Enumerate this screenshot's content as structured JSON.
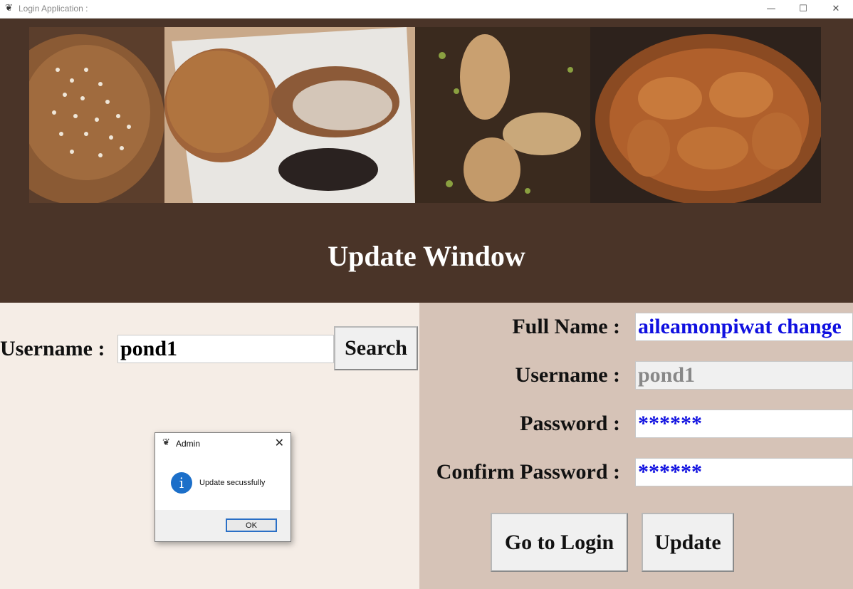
{
  "window": {
    "title": "Login Application :",
    "icon": "feather-icon",
    "controls": {
      "minimize": "—",
      "maximize": "☐",
      "close": "✕"
    }
  },
  "header": {
    "banner_image": "bakery bread photos",
    "title": "Update Window"
  },
  "search": {
    "username_label": "Username :",
    "username_value": "pond1",
    "search_button": "Search"
  },
  "form": {
    "fullname_label": "Full Name :",
    "fullname_value": "aileamonpiwat change",
    "username_label": "Username :",
    "username_value": "pond1",
    "password_label": "Password :",
    "password_value": "******",
    "confirm_label": "Confirm Password :",
    "confirm_value": "******",
    "goto_login_button": "Go to Login",
    "update_button": "Update"
  },
  "dialog": {
    "title": "Admin",
    "message": "Update secussfully",
    "ok_button": "OK",
    "icon": "info-icon"
  },
  "colors": {
    "header_bg": "#4a3428",
    "left_bg": "#f5ede6",
    "right_bg": "#d6c3b7",
    "entry_text_blue": "#1010e0"
  }
}
